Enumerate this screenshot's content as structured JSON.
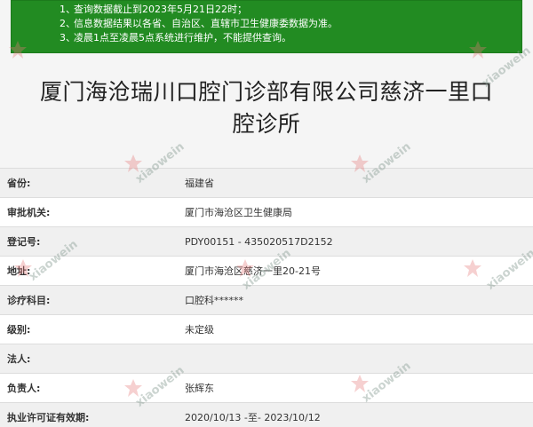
{
  "notice": {
    "items": [
      {
        "num": "1、",
        "text": "查询数据截止到2023年5月21日22时；"
      },
      {
        "num": "2、",
        "text": "信息数据结果以各省、自治区、直辖市卫生健康委数据为准。"
      },
      {
        "num": "3、",
        "text": "凌晨1点至凌晨5点系统进行维护，不能提供查询。"
      }
    ]
  },
  "title": {
    "line1": "厦门海沧瑞川口腔门诊部有限公司慈济一里口",
    "line2": "腔诊所"
  },
  "details": [
    {
      "label": "省份:",
      "value": "福建省"
    },
    {
      "label": "审批机关:",
      "value": "厦门市海沧区卫生健康局"
    },
    {
      "label": "登记号:",
      "value": "PDY00151 - 435020517D2152"
    },
    {
      "label": "地址:",
      "value": "厦门市海沧区慈济一里20-21号"
    },
    {
      "label": "诊疗科目:",
      "value": "口腔科******"
    },
    {
      "label": "级别:",
      "value": "未定级"
    },
    {
      "label": "法人:",
      "value": ""
    },
    {
      "label": "负责人:",
      "value": "张辉东"
    },
    {
      "label": "执业许可证有效期:",
      "value": "2020/10/13 -至- 2023/10/12"
    }
  ],
  "watermarks": [
    "xiaowein",
    "xiaowein",
    "xiaowein",
    "xiaowein",
    "xiaowein",
    "xiaowein",
    "xiaowein",
    "xiaowein"
  ],
  "colors": {
    "notice_bg": "#228b22",
    "notice_text": "#ffffff",
    "title_text": "#222222"
  }
}
